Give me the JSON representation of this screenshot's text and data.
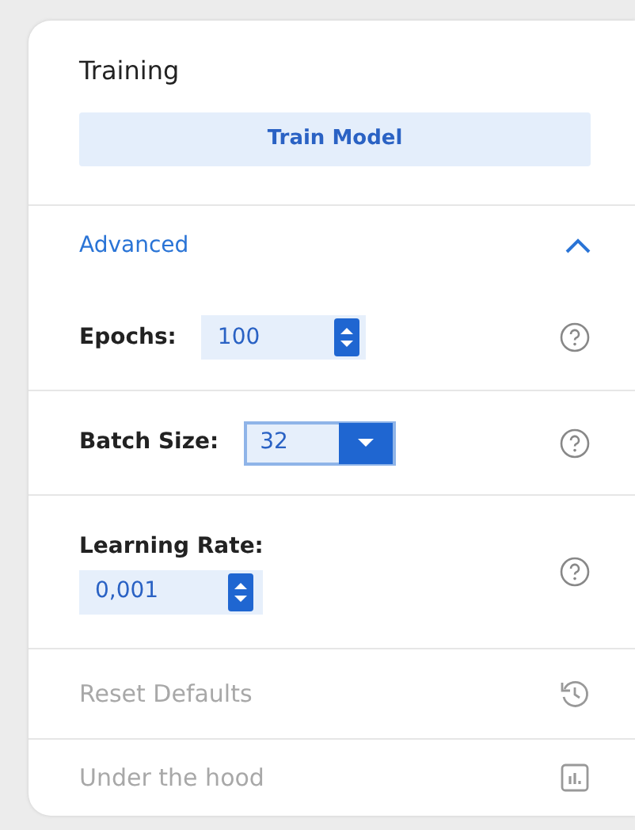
{
  "panel": {
    "title": "Training",
    "primary_button": "Train Model"
  },
  "advanced": {
    "label": "Advanced",
    "expanded": true
  },
  "fields": [
    {
      "kind": "spinner",
      "label": "Epochs:",
      "value": "100",
      "label_above": false,
      "focused": false
    },
    {
      "kind": "dropdown",
      "label": "Batch Size:",
      "value": "32",
      "label_above": false,
      "focused": true
    },
    {
      "kind": "spinner",
      "label": "Learning Rate:",
      "value": "0,001",
      "label_above": true,
      "focused": false
    }
  ],
  "actions": [
    {
      "label": "Reset Defaults",
      "disabled": true
    },
    {
      "label": "Under the hood",
      "disabled": true
    }
  ]
}
